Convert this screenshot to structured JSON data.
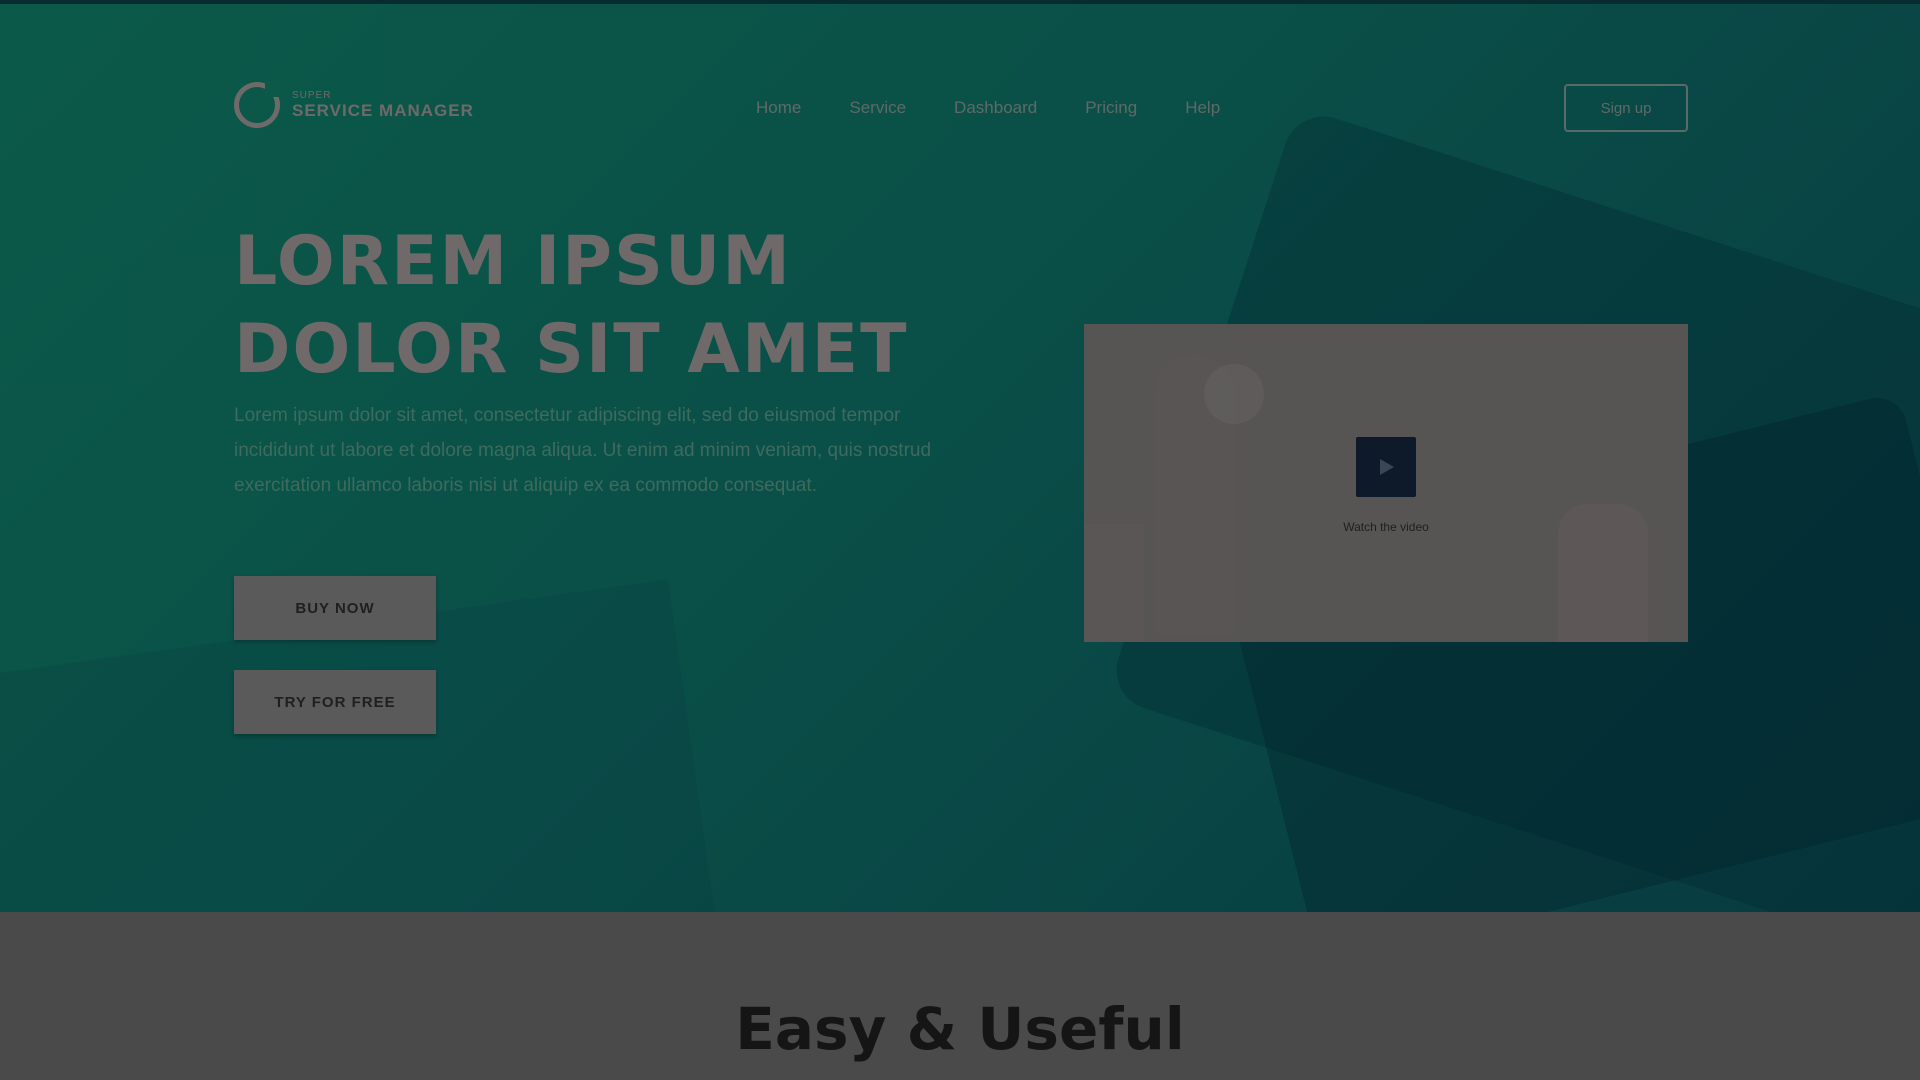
{
  "colors": {
    "hero_gradient_start": "#0b5a49",
    "hero_gradient_end": "#073a40",
    "button_bg": "#5a5a5a",
    "play_button_bg": "#0e1a2a",
    "section_bg": "#4a4a4a"
  },
  "logo": {
    "tagline": "SUPER",
    "name": "SERVICE MANAGER",
    "icon": "logo-icon"
  },
  "nav": {
    "items": [
      {
        "label": "Home"
      },
      {
        "label": "Service"
      },
      {
        "label": "Dashboard"
      },
      {
        "label": "Pricing"
      },
      {
        "label": "Help"
      }
    ],
    "signup_label": "Sign up"
  },
  "hero": {
    "title_line1": "LOREM IPSUM",
    "title_line2": "DOLOR SIT AMET",
    "description": "Lorem ipsum dolor sit amet, consectetur adipiscing elit, sed do eiusmod tempor incididunt ut labore et dolore magna aliqua. Ut enim ad minim veniam, quis nostrud exercitation ullamco laboris nisi ut aliquip ex ea commodo consequat.",
    "buy_label": "BUY NOW",
    "try_label": "TRY FOR FREE"
  },
  "video": {
    "play_icon": "play-icon",
    "label": "Watch the video"
  },
  "section": {
    "title": "Easy & Useful"
  }
}
